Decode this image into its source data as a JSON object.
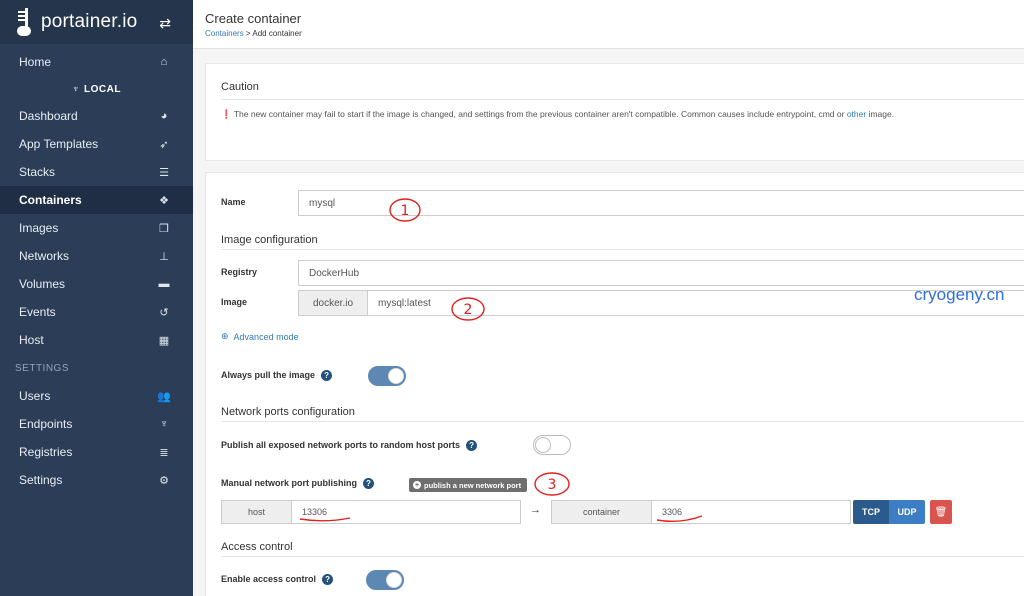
{
  "brand": {
    "name": "portainer.io"
  },
  "sidebar": {
    "home": "Home",
    "endpoint_header": "LOCAL",
    "items": [
      {
        "label": "Dashboard",
        "icon": "tachometer-icon",
        "glyph": "◕"
      },
      {
        "label": "App Templates",
        "icon": "rocket-icon",
        "glyph": "➶"
      },
      {
        "label": "Stacks",
        "icon": "list-icon",
        "glyph": "☰"
      },
      {
        "label": "Containers",
        "icon": "cubes-icon",
        "glyph": "❖"
      },
      {
        "label": "Images",
        "icon": "clone-icon",
        "glyph": "❐"
      },
      {
        "label": "Networks",
        "icon": "sitemap-icon",
        "glyph": "⊥"
      },
      {
        "label": "Volumes",
        "icon": "hdd-icon",
        "glyph": "▬"
      },
      {
        "label": "Events",
        "icon": "history-icon",
        "glyph": "↺"
      },
      {
        "label": "Host",
        "icon": "th-icon",
        "glyph": "▦"
      }
    ],
    "settings_header": "SETTINGS",
    "settings_items": [
      {
        "label": "Users",
        "icon": "users-icon",
        "glyph": "👥"
      },
      {
        "label": "Endpoints",
        "icon": "plug-icon",
        "glyph": "♆"
      },
      {
        "label": "Registries",
        "icon": "database-icon",
        "glyph": "≣"
      },
      {
        "label": "Settings",
        "icon": "cogs-icon",
        "glyph": "⚙"
      }
    ],
    "active": "Containers"
  },
  "header": {
    "title": "Create container",
    "breadcrumb_link": "Containers",
    "breadcrumb_sep": " > ",
    "breadcrumb_current": "Add container"
  },
  "caution": {
    "title": "Caution",
    "text_before": "The new container may fail to start if the image is changed, and settings from the previous container aren't compatible. Common causes include entrypoint, cmd or ",
    "link": "other",
    "text_after": " image."
  },
  "form": {
    "name_label": "Name",
    "name_value": "mysql",
    "image_section": "Image configuration",
    "registry_label": "Registry",
    "registry_value": "DockerHub",
    "image_label": "Image",
    "image_prefix": "docker.io",
    "image_value": "mysql:latest",
    "advanced_mode": "Advanced mode",
    "always_pull_label": "Always pull the image",
    "always_pull": true,
    "network_section": "Network ports configuration",
    "publish_all_label": "Publish all exposed network ports to random host ports",
    "publish_all": false,
    "manual_label": "Manual network port publishing",
    "publish_new_button": "publish a new network port",
    "port_mapping": {
      "host_label": "host",
      "host_value": "13306",
      "container_label": "container",
      "container_value": "3306",
      "tcp": "TCP",
      "udp": "UDP"
    },
    "access_section": "Access control",
    "enable_access_label": "Enable access control",
    "enable_access": true
  },
  "annotations": {
    "watermark": "cryogeny.cn",
    "marks": [
      "1",
      "2",
      "3"
    ]
  },
  "colors": {
    "sidebar_bg": "#2b3d57",
    "accent": "#337ab7",
    "toggle_on": "#5e88b4",
    "danger": "#d9534f",
    "annotation_red": "#e0201b"
  }
}
